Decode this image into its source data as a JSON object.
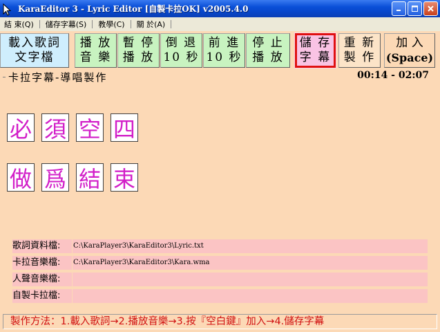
{
  "window": {
    "title": "KaraEditor 3 - Lyric Editor [自製卡拉OK] v2005.4.0",
    "icon": "cursor-arrow-icon",
    "controls": [
      "minimize-icon",
      "maximize-icon",
      "close-icon"
    ]
  },
  "menu": [
    {
      "label": "結 束(Q)"
    },
    {
      "label": "儲存字幕(S)"
    },
    {
      "label": "教學(C)"
    },
    {
      "label": "關 於(A)"
    }
  ],
  "toolbar": {
    "load": "載入歌詞\n文字檔",
    "play": "播 放\n音 樂",
    "pause": "暫 停\n播 放",
    "rewind": "倒 退\n10 秒",
    "forward": "前 進\n10 秒",
    "stop": "停 止\n播 放",
    "save": "儲 存\n字 幕",
    "redo": "重 新\n製 作",
    "add_line1": "加 入",
    "add_line2": "(Space)"
  },
  "section": {
    "title": "卡拉字幕-導唱製作",
    "time": "00:14 - 02:07"
  },
  "lyrics": {
    "line1": [
      "必",
      "須",
      "空",
      "四"
    ],
    "line2": [
      "做",
      "爲",
      "結",
      "束"
    ]
  },
  "files": [
    {
      "label": "歌詞資料檔:",
      "value": "C:\\KaraPlayer3\\KaraEditor3\\Lyric.txt"
    },
    {
      "label": "卡拉音樂檔:",
      "value": "C:\\KaraPlayer3\\KaraEditor3\\Kara.wma"
    },
    {
      "label": "人聲音樂檔:",
      "value": ""
    },
    {
      "label": "自製卡拉檔:",
      "value": ""
    }
  ],
  "footer": "製作方法：1.載入歌詞→2.播放音樂→3.按『空白鍵』加入→4.儲存字幕",
  "colors": {
    "background": "#fcd9b6",
    "lyric_text": "#d21ec8",
    "footer_text": "#d01010",
    "highlight_border": "#e01010",
    "info_bg": "#fbc4c4"
  }
}
